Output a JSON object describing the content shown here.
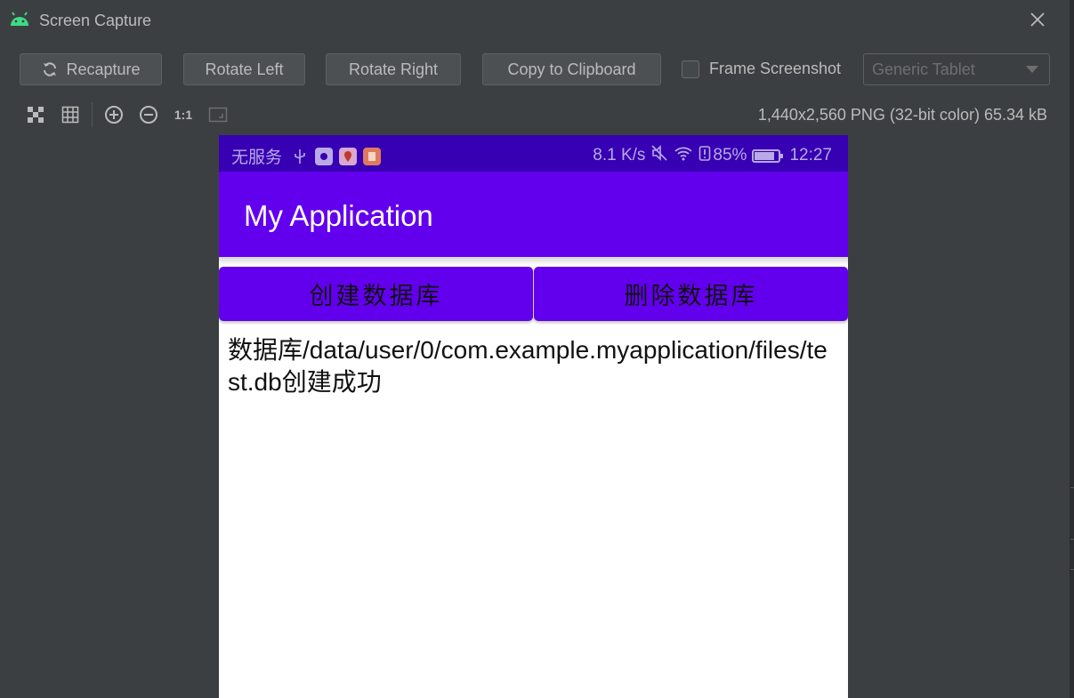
{
  "window": {
    "title": "Screen Capture",
    "icon": "android-icon",
    "accent_color": "#3ddc84"
  },
  "toolbar": {
    "recapture_label": "Recapture",
    "rotate_left_label": "Rotate Left",
    "rotate_right_label": "Rotate Right",
    "copy_label": "Copy to Clipboard",
    "frame_label": "Frame Screenshot",
    "frame_checked": false,
    "device_value": "Generic Tablet"
  },
  "view_tools": {
    "actual_size_label": "1:1",
    "image_info": "1,440x2,560 PNG (32-bit color) 65.34 kB"
  },
  "phone": {
    "status": {
      "carrier": "无服务",
      "speed": "8.1 K/s",
      "battery": "85%",
      "battery_level": 0.85,
      "time": "12:27"
    },
    "app_title": "My Application",
    "create_button": "创建数据库",
    "delete_button": "删除数据库",
    "result_text": "数据库/data/user/0/com.example.myapplication/files/test.db创建成功",
    "colors": {
      "primary": "#6200ee",
      "primary_dark": "#3700b3"
    }
  }
}
